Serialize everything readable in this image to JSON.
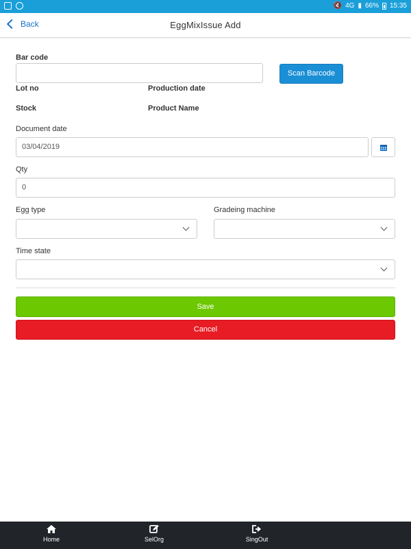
{
  "status_bar": {
    "battery": "66%",
    "time": "15:35",
    "network": "4G"
  },
  "header": {
    "back_label": "Back",
    "title": "EggMixIssue Add"
  },
  "form": {
    "barcode": {
      "label": "Bar code",
      "value": ""
    },
    "scan_button": "Scan Barcode",
    "lot_no_label": "Lot no",
    "production_date_label": "Production date",
    "stock_label": "Stock",
    "product_name_label": "Product Name",
    "document_date": {
      "label": "Document date",
      "value": "03/04/2019"
    },
    "qty": {
      "label": "Qty",
      "value": "0"
    },
    "egg_type": {
      "label": "Egg type",
      "value": ""
    },
    "grading_machine": {
      "label": "Gradeing machine",
      "value": ""
    },
    "time_state": {
      "label": "Time state",
      "value": ""
    },
    "save_label": "Save",
    "cancel_label": "Cancel"
  },
  "tabbar": {
    "items": [
      {
        "label": "Home",
        "icon": "home-icon"
      },
      {
        "label": "SelOrg",
        "icon": "edit-icon"
      },
      {
        "label": "SingOut",
        "icon": "sign-out-icon"
      }
    ]
  },
  "colors": {
    "status_bar": "#1a9fd9",
    "accent": "#1a73c8",
    "save": "#6cc800",
    "cancel": "#e81c24",
    "tabbar": "#212529"
  }
}
